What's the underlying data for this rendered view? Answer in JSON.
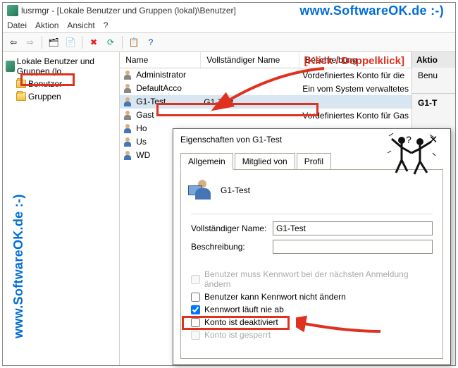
{
  "watermark_top": "www.SoftwareOK.de :-)",
  "watermark_side": "www.SoftwareOK.de :-)",
  "annotation_klick": "[Klick / Doppelklick]",
  "window": {
    "title": "lusrmgr - [Lokale Benutzer und Gruppen (lokal)\\Benutzer]"
  },
  "menu": [
    "Datei",
    "Aktion",
    "Ansicht",
    "?"
  ],
  "tree": {
    "root": "Lokale Benutzer und Gruppen (lo",
    "children": [
      "Benutzer",
      "Gruppen"
    ]
  },
  "columns": {
    "name": "Name",
    "full": "Vollständiger Name",
    "desc": "Beschreibung"
  },
  "actions_header": "Aktio",
  "actions": [
    "Benu",
    "",
    "G1-T"
  ],
  "users": [
    {
      "name": "Administrator",
      "full": "",
      "desc": "Vordefiniertes Konto für die",
      "disabled": true
    },
    {
      "name": "DefaultAcco",
      "full": "",
      "desc": "Ein vom System verwaltetes",
      "disabled": true
    },
    {
      "name": "G1-Test",
      "full": "G1-Test",
      "desc": "",
      "selected": true
    },
    {
      "name": "Gast",
      "full": "",
      "desc": "Vordefiniertes Konto für Gas",
      "disabled": true
    },
    {
      "name": "Ho",
      "full": "",
      "desc": ""
    },
    {
      "name": "Us",
      "full": "",
      "desc": ""
    },
    {
      "name": "WD",
      "full": "",
      "desc": ""
    }
  ],
  "dialog": {
    "title": "Eigenschaften von G1-Test",
    "tabs": [
      "Allgemein",
      "Mitglied von",
      "Profil"
    ],
    "username": "G1-Test",
    "fields": {
      "fullname_label": "Vollständiger Name:",
      "fullname_value": "G1-Test",
      "desc_label": "Beschreibung:",
      "desc_value": ""
    },
    "checkboxes": {
      "must_change": {
        "label": "Benutzer muss Kennwort bei der nächsten Anmeldung ändern",
        "checked": false,
        "disabled": true
      },
      "cannot_change": {
        "label": "Benutzer kann Kennwort nicht ändern",
        "checked": false,
        "disabled": false
      },
      "never_expires": {
        "label": "Kennwort läuft nie ab",
        "checked": true,
        "disabled": false
      },
      "deactivated": {
        "label": "Konto ist deaktiviert",
        "checked": false,
        "disabled": false
      },
      "locked": {
        "label": "Konto ist gesperrt",
        "checked": false,
        "disabled": true
      }
    }
  }
}
